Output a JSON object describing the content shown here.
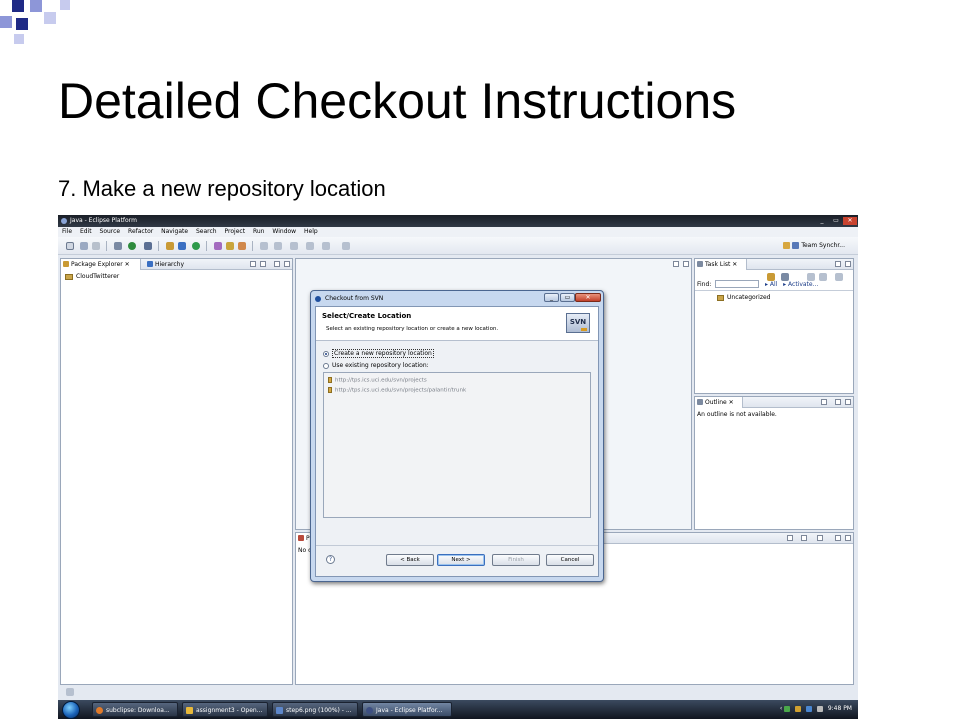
{
  "slide": {
    "title": "Detailed Checkout Instructions",
    "subtitle": "7. Make a new repository location"
  },
  "window": {
    "title": "Java - Eclipse Platform",
    "minimize": "_",
    "maximize": "▭",
    "close": "✕"
  },
  "menu": [
    "File",
    "Edit",
    "Source",
    "Refactor",
    "Navigate",
    "Search",
    "Project",
    "Run",
    "Window",
    "Help"
  ],
  "toolbar": {
    "perspective_label": "Team Synchr..."
  },
  "package_explorer": {
    "tab_label": "Package Explorer",
    "hierarchy_tab_label": "Hierarchy",
    "project": "CloudTwitterer"
  },
  "task_list": {
    "tab_label": "Task List",
    "find_label": "Find:",
    "all_link": "All",
    "activate_link": "Activate...",
    "category": "Uncategorized"
  },
  "outline": {
    "tab_label": "Outline",
    "empty_message": "An outline is not available."
  },
  "bottom_pane": {
    "tab_label": "P",
    "body_text": "No co"
  },
  "dialog": {
    "title": "Checkout from SVN",
    "header_title": "Select/Create Location",
    "header_desc": "Select an existing repository location or create a new location.",
    "svn_logo": "SVN",
    "options": {
      "create": "Create a new repository location",
      "existing": "Use existing repository location:"
    },
    "selected_option": "create",
    "repositories": [
      "http://tps.ics.uci.edu/svn/projects",
      "http://tps.ics.uci.edu/svn/projects/palantir/trunk"
    ],
    "buttons": {
      "back": "< Back",
      "next": "Next >",
      "finish": "Finish",
      "cancel": "Cancel"
    },
    "help": "?"
  },
  "taskbar": {
    "items": [
      {
        "label": "subclipse: Downloa..."
      },
      {
        "label": "assignment3 - Open..."
      },
      {
        "label": "step6.png (100%) - ..."
      },
      {
        "label": "Java - Eclipse Platfor..."
      }
    ],
    "clock": "9:48 PM"
  }
}
